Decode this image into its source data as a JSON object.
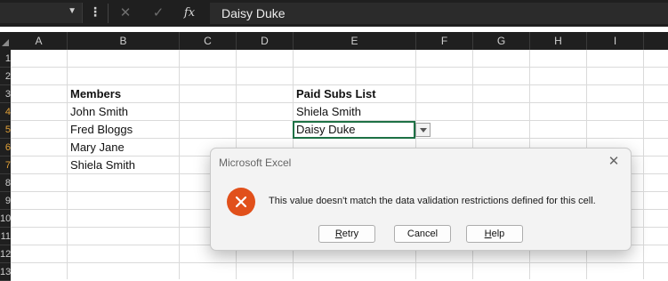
{
  "formula_bar": {
    "name_box_value": "",
    "formula_value": "Daisy Duke",
    "cancel_icon": "x-icon",
    "enter_icon": "check-icon",
    "function_icon_label": "fx"
  },
  "columns": [
    "A",
    "B",
    "C",
    "D",
    "E",
    "F",
    "G",
    "H",
    "I"
  ],
  "rows": [
    "1",
    "2",
    "3",
    "4",
    "5",
    "6",
    "7",
    "8",
    "9",
    "10",
    "11",
    "12",
    "13"
  ],
  "selected_rows": [
    "4",
    "5",
    "6",
    "7"
  ],
  "sheet": {
    "members_header": "Members",
    "members": [
      "John Smith",
      "Fred Bloggs",
      "Mary Jane",
      "Shiela Smith"
    ],
    "paid_header": "Paid Subs List",
    "paid": [
      "Shiela Smith",
      "Daisy Duke"
    ]
  },
  "dialog": {
    "title": "Microsoft Excel",
    "message": "This value doesn't match the data validation restrictions defined for this cell.",
    "icon": "error-icon",
    "buttons": {
      "retry_first": "R",
      "retry_rest": "etry",
      "cancel": "Cancel",
      "help_first": "H",
      "help_rest": "elp"
    }
  },
  "colors": {
    "accent": "#1e7145",
    "error": "#e1501b",
    "row_highlight": "#e3a33a"
  }
}
